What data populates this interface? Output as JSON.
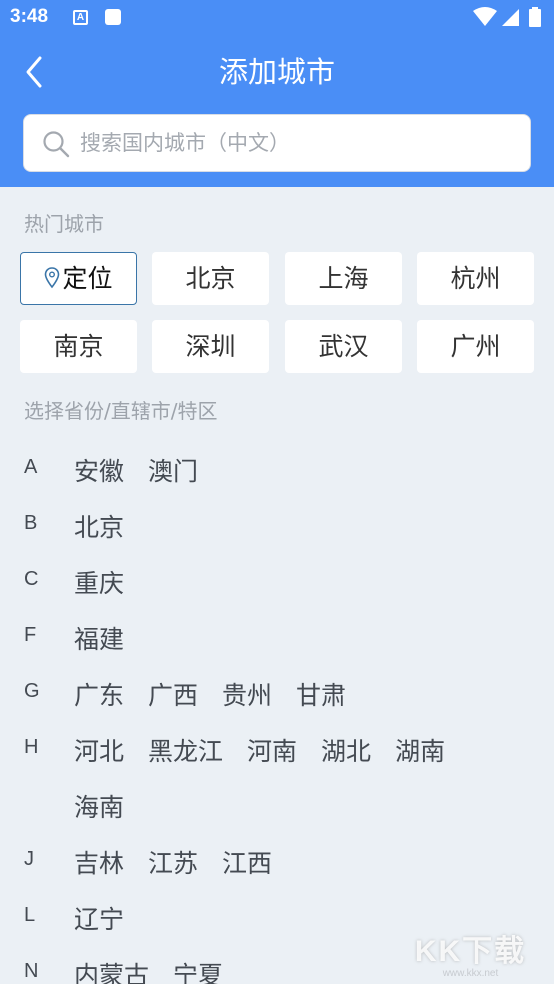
{
  "status": {
    "time": "3:48",
    "a_icon_letter": "A"
  },
  "header": {
    "title": "添加城市"
  },
  "search": {
    "placeholder": "搜索国内城市（中文）"
  },
  "hot": {
    "label": "热门城市",
    "locate_label": "定位",
    "cities": [
      "北京",
      "上海",
      "杭州",
      "南京",
      "深圳",
      "武汉",
      "广州"
    ]
  },
  "provinces": {
    "label": "选择省份/直辖市/特区",
    "groups": [
      {
        "letter": "A",
        "items": [
          "安徽",
          "澳门"
        ]
      },
      {
        "letter": "B",
        "items": [
          "北京"
        ]
      },
      {
        "letter": "C",
        "items": [
          "重庆"
        ]
      },
      {
        "letter": "F",
        "items": [
          "福建"
        ]
      },
      {
        "letter": "G",
        "items": [
          "广东",
          "广西",
          "贵州",
          "甘肃"
        ]
      },
      {
        "letter": "H",
        "items": [
          "河北",
          "黑龙江",
          "河南",
          "湖北",
          "湖南"
        ]
      },
      {
        "letter": "",
        "items": [
          "海南"
        ]
      },
      {
        "letter": "J",
        "items": [
          "吉林",
          "江苏",
          "江西"
        ]
      },
      {
        "letter": "L",
        "items": [
          "辽宁"
        ]
      },
      {
        "letter": "N",
        "items": [
          "内蒙古",
          "宁夏"
        ]
      }
    ]
  },
  "watermark": {
    "main": "KK下载",
    "sub": "www.kkx.net"
  },
  "colors": {
    "header": "#4a8ef6",
    "background": "#ebf0f5"
  }
}
